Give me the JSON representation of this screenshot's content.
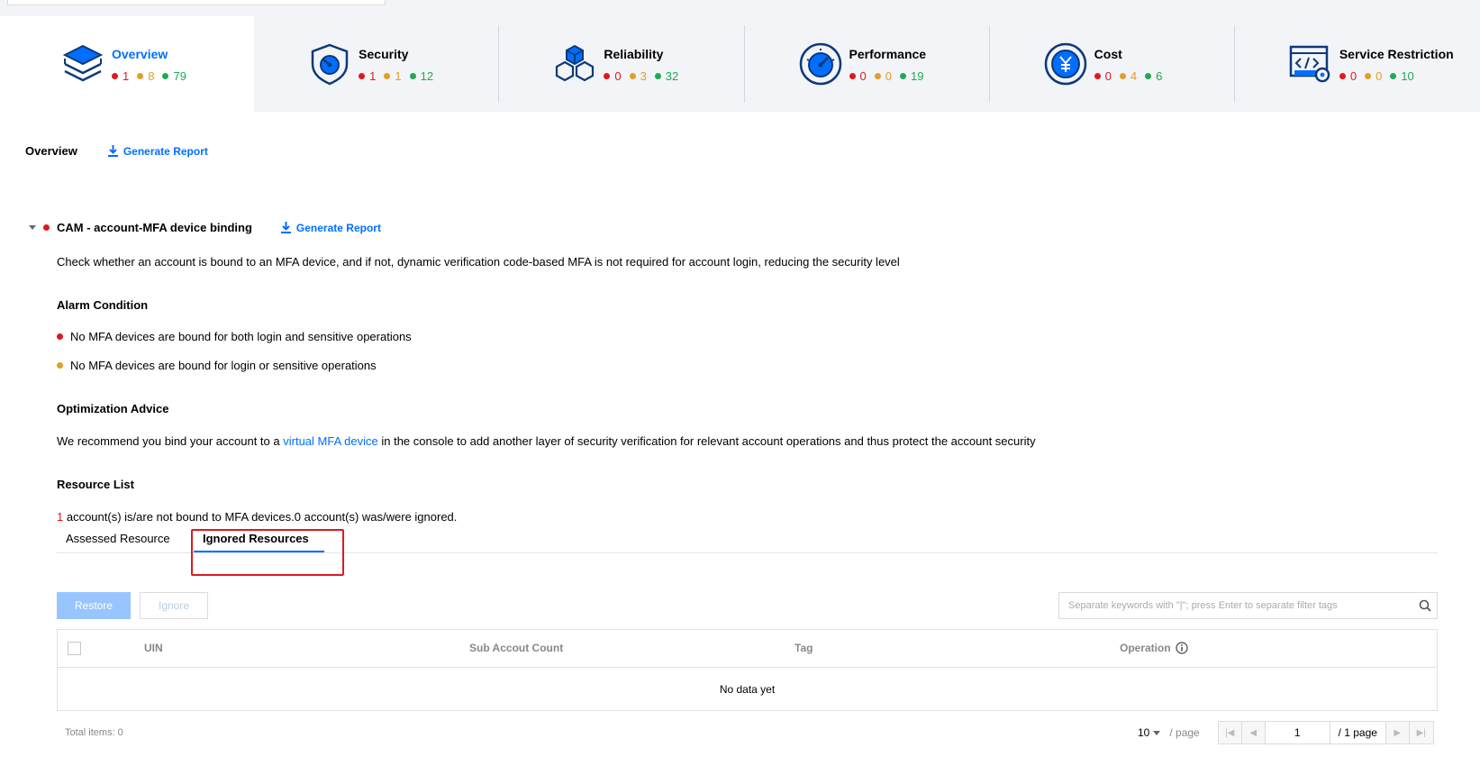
{
  "categories": [
    {
      "name": "Overview",
      "icon": "layers-icon",
      "active": true,
      "counts": {
        "high": "1",
        "medium": "8",
        "low": "79"
      }
    },
    {
      "name": "Security",
      "icon": "shield-icon",
      "active": false,
      "counts": {
        "high": "1",
        "medium": "1",
        "low": "12"
      }
    },
    {
      "name": "Reliability",
      "icon": "cubes-icon",
      "active": false,
      "counts": {
        "high": "0",
        "medium": "3",
        "low": "32"
      }
    },
    {
      "name": "Performance",
      "icon": "gauge-icon",
      "active": false,
      "counts": {
        "high": "0",
        "medium": "0",
        "low": "19"
      }
    },
    {
      "name": "Cost",
      "icon": "yen-coin-icon",
      "active": false,
      "counts": {
        "high": "0",
        "medium": "4",
        "low": "6"
      }
    },
    {
      "name": "Service Restriction",
      "icon": "code-gear-icon",
      "active": false,
      "counts": {
        "high": "0",
        "medium": "0",
        "low": "10"
      }
    }
  ],
  "overview": {
    "title": "Overview",
    "generate_report": "Generate Report"
  },
  "check": {
    "title": "CAM - account-MFA device binding",
    "generate_report": "Generate Report",
    "description": "Check whether an account is bound to an MFA device, and if not, dynamic verification code-based MFA is not required for account login, reducing the security level",
    "alarm_title": "Alarm Condition",
    "alarm_high": "No MFA devices are bound for both login and sensitive operations",
    "alarm_medium": "No MFA devices are bound for login or sensitive operations",
    "advice_title": "Optimization Advice",
    "advice_prefix": "We recommend you bind your account to a ",
    "advice_link": "virtual MFA device",
    "advice_suffix": " in the console to add another layer of security verification for relevant account operations and thus protect the account security",
    "resource_title": "Resource List",
    "summary_count": "1",
    "summary_text": " account(s) is/are not bound to MFA devices.0  account(s) was/were ignored."
  },
  "resource_tabs": {
    "assessed": "Assessed Resource",
    "ignored": "Ignored Resources"
  },
  "toolbar": {
    "restore_label": "Restore",
    "ignore_label": "Ignore",
    "search_placeholder": "Separate keywords with \"|\"; press Enter to separate filter tags"
  },
  "table": {
    "columns": {
      "uin": "UIN",
      "sub_count": "Sub Accout Count",
      "tag": "Tag",
      "operation": "Operation"
    },
    "empty_text": "No data yet"
  },
  "pagination": {
    "total": "Total items:  0",
    "page_size": "10",
    "per_page": "/ page",
    "current_page": "1",
    "total_pages": "/ 1 page"
  },
  "colors": {
    "accent": "#006eff",
    "high": "#e1181e",
    "medium": "#e29e27",
    "low": "#1dab55"
  }
}
